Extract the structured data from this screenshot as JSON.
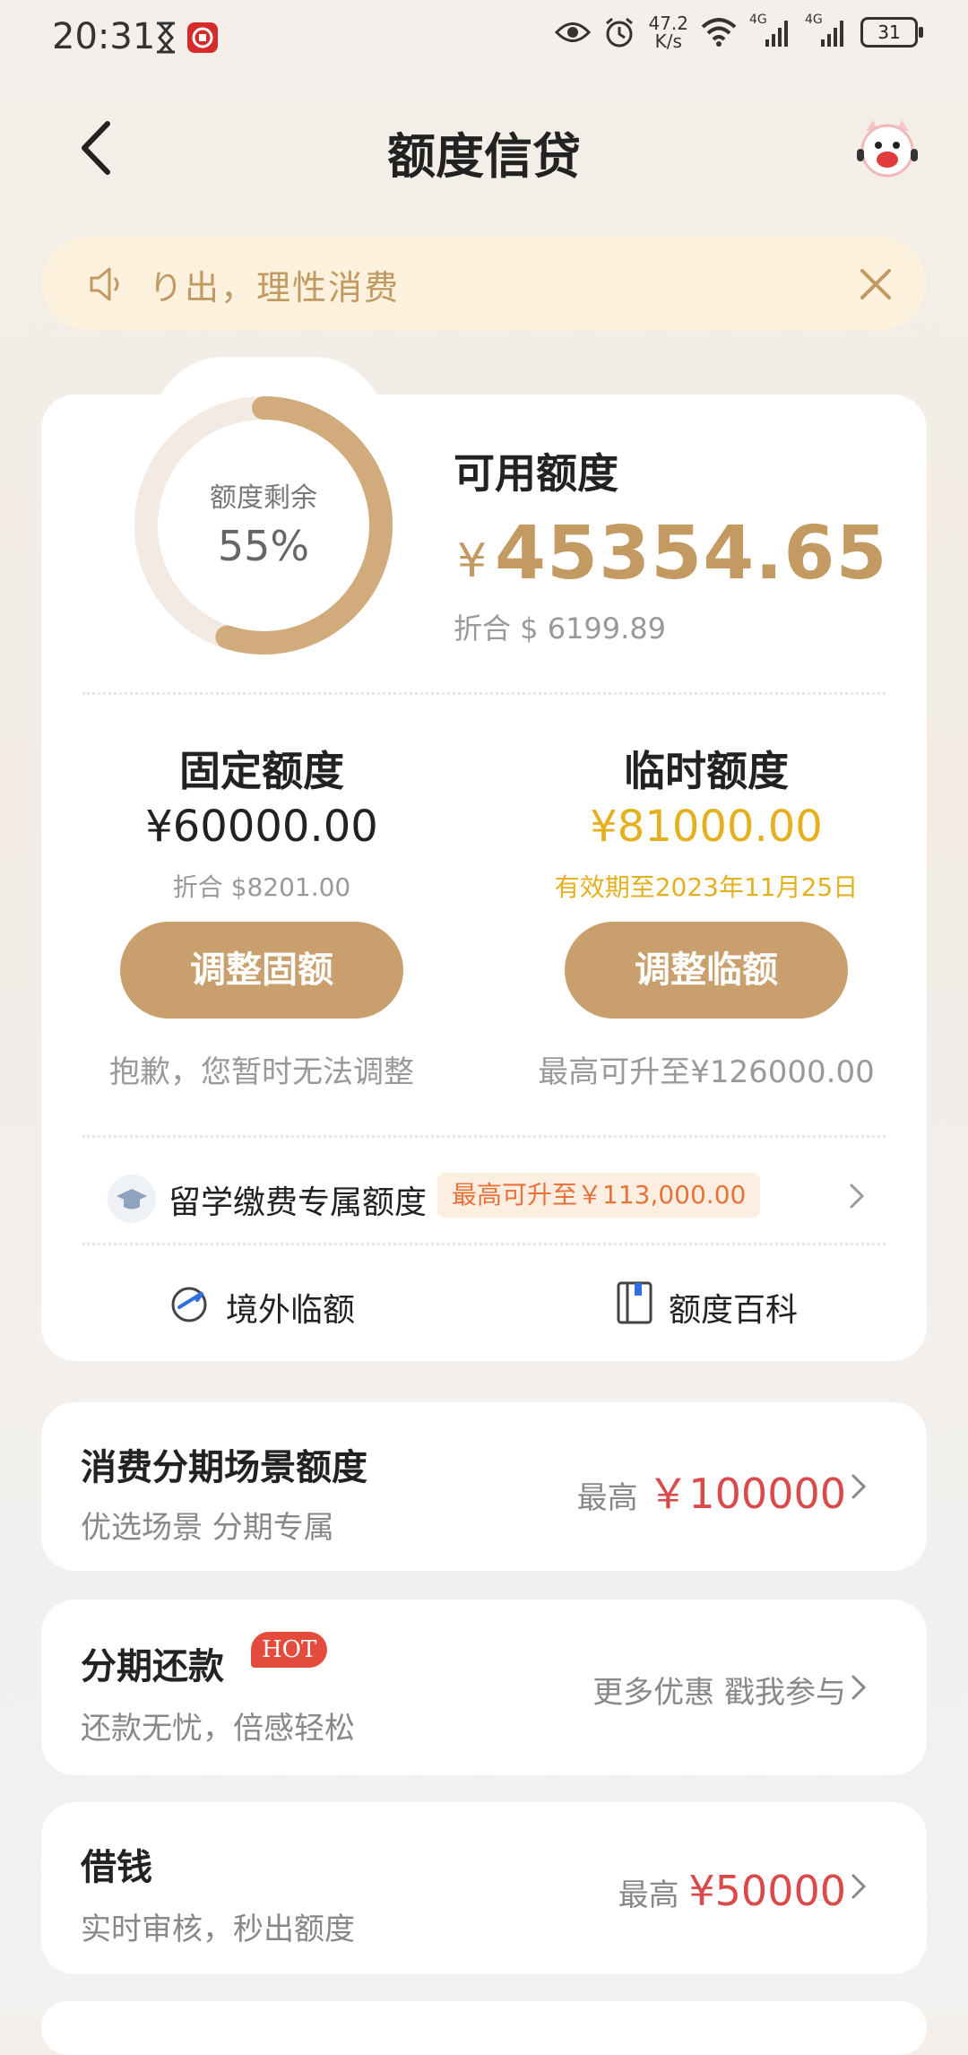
{
  "status_bar": {
    "time": "20:31",
    "net_speed_value": "47.2",
    "net_speed_unit": "K/s",
    "signal1_label": "4G",
    "signal2_label": "4G",
    "battery": "31"
  },
  "header": {
    "title": "额度信贷",
    "back_icon": "chevron-left-icon",
    "mascot_icon": "mascot-avatar-icon"
  },
  "notice": {
    "text": "り出，理性消费",
    "icon": "speaker-icon",
    "close_icon": "close-icon"
  },
  "credit": {
    "ring_label": "额度剩余",
    "ring_percent": "55%",
    "ring_fraction": 0.55,
    "available_label": "可用额度",
    "currency_symbol": "¥",
    "available_amount": "45354.65",
    "usd_equiv": "折合 $ 6199.89",
    "fixed": {
      "title": "固定额度",
      "amount": "¥60000.00",
      "sub": "折合 $8201.00",
      "button": "调整固额",
      "note": "抱歉，您暂时无法调整"
    },
    "temporary": {
      "title": "临时额度",
      "amount": "¥81000.00",
      "sub": "有效期至2023年11月25日",
      "button": "调整临额",
      "note": "最高可升至¥126000.00"
    },
    "study_abroad": {
      "label": "留学缴费专属额度",
      "badge": "最高可升至￥113,000.00",
      "icon": "graduation-cap-icon"
    },
    "links": [
      {
        "label": "境外临额",
        "icon": "globe-plane-icon"
      },
      {
        "label": "额度百科",
        "icon": "book-icon"
      }
    ]
  },
  "list": [
    {
      "title": "消费分期场景额度",
      "sub": "优选场景 分期专属",
      "right_prefix": "最高",
      "right_value": "￥100000"
    },
    {
      "title": "分期还款",
      "badge": "HOT",
      "sub": "还款无忧，倍感轻松",
      "right_text": "更多优惠 戳我参与"
    },
    {
      "title": "借钱",
      "sub": "实时审核，秒出额度",
      "right_prefix": "最高",
      "right_value": "¥50000"
    }
  ],
  "colors": {
    "accent_gold": "#c9a06d",
    "temp_gold": "#e5b020",
    "red": "#d94a4a",
    "hot_red": "#e34b3c"
  }
}
